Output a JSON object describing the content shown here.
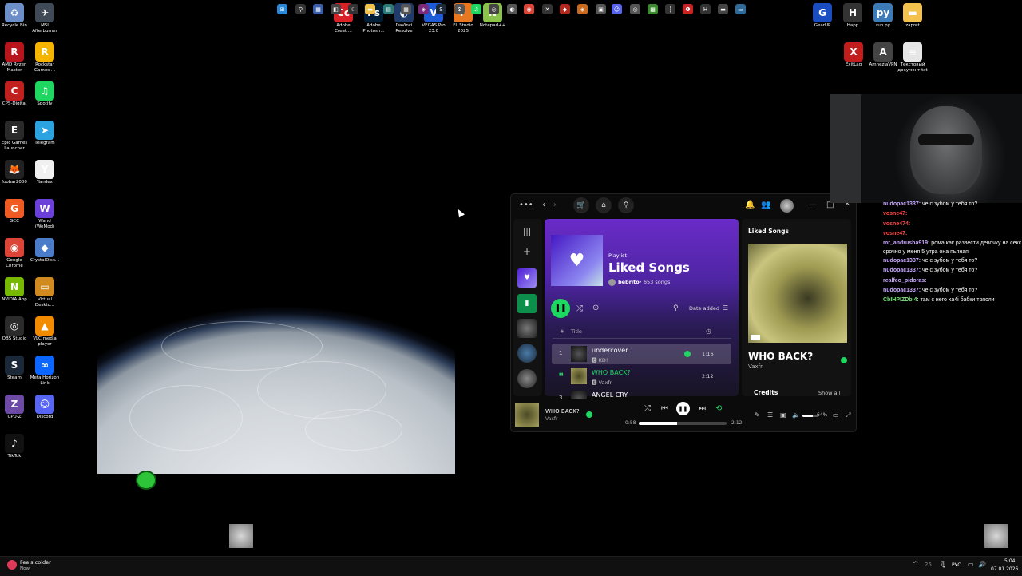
{
  "desktop": {
    "icons_left": [
      {
        "label": "Recycle Bin",
        "icon": "recycle-bin-icon",
        "color": "#6c8ec9",
        "glyph": "♻"
      },
      {
        "label": "MSI Afterburner",
        "icon": "msi-afterburner-icon",
        "color": "#3f4a56",
        "glyph": "✈"
      },
      {
        "label": "AMD Ryzen Master",
        "icon": "amd-ryzen-icon",
        "color": "#b8141b",
        "glyph": "R"
      },
      {
        "label": "Rockstar Games ...",
        "icon": "rockstar-icon",
        "color": "#f5b400",
        "glyph": "R"
      },
      {
        "label": "CPS-Digital",
        "icon": "cps-digital-icon",
        "color": "#c2201f",
        "glyph": "C"
      },
      {
        "label": "Spotify",
        "icon": "spotify-icon",
        "color": "#1ed760",
        "glyph": "♫"
      },
      {
        "label": "Epic Games Launcher",
        "icon": "epic-games-icon",
        "color": "#2a2a2a",
        "glyph": "E"
      },
      {
        "label": "Telegram",
        "icon": "telegram-icon",
        "color": "#2aa3e0",
        "glyph": "➤"
      },
      {
        "label": "foobar2000",
        "icon": "foobar-icon",
        "color": "#222",
        "glyph": "🦊"
      },
      {
        "label": "Yandex",
        "icon": "yandex-icon",
        "color": "#f0f0f0",
        "glyph": "Y"
      },
      {
        "label": "GCC",
        "icon": "gcc-icon",
        "color": "#f05a23",
        "glyph": "G"
      },
      {
        "label": "Wand (WeMod)",
        "icon": "wand-icon",
        "color": "#6b3fd9",
        "glyph": "W"
      },
      {
        "label": "Google Chrome",
        "icon": "chrome-icon",
        "color": "#db4437",
        "glyph": "◉"
      },
      {
        "label": "CrystalDisk...",
        "icon": "crystaldisk-icon",
        "color": "#4b7cc9",
        "glyph": "◆"
      },
      {
        "label": "NVIDIA App",
        "icon": "nvidia-icon",
        "color": "#76b900",
        "glyph": "N"
      },
      {
        "label": "Virtual Deskto...",
        "icon": "virtual-desktop-icon",
        "color": "#d08a1e",
        "glyph": "▭"
      },
      {
        "label": "OBS Studio",
        "icon": "obs-icon",
        "color": "#2b2b2b",
        "glyph": "◎"
      },
      {
        "label": "VLC media player",
        "icon": "vlc-icon",
        "color": "#f28b00",
        "glyph": "▲"
      },
      {
        "label": "Steam",
        "icon": "steam-icon",
        "color": "#1b2838",
        "glyph": "S"
      },
      {
        "label": "Meta Horizon Link",
        "icon": "meta-icon",
        "color": "#0a66ff",
        "glyph": "∞"
      },
      {
        "label": "CPU-Z",
        "icon": "cpuz-icon",
        "color": "#6c4aa6",
        "glyph": "Z"
      },
      {
        "label": "Discord",
        "icon": "discord-icon",
        "color": "#5865f2",
        "glyph": "☺"
      },
      {
        "label": "TikTok",
        "icon": "tiktok-icon",
        "color": "#111",
        "glyph": "♪"
      }
    ],
    "icons_top": [
      {
        "label": "Adobe Creati...",
        "icon": "adobe-cc-icon",
        "color": "#da1f26",
        "glyph": "Cc"
      },
      {
        "label": "Adobe Photosh...",
        "icon": "photoshop-icon",
        "color": "#001e36",
        "glyph": "Ps"
      },
      {
        "label": "DaVinci Resolve",
        "icon": "davinci-icon",
        "color": "#1f3b6b",
        "glyph": "◐"
      },
      {
        "label": "VEGAS Pro 23.0",
        "icon": "vegas-icon",
        "color": "#1e5bd6",
        "glyph": "V"
      },
      {
        "label": "FL Studio 2025",
        "icon": "fl-studio-icon",
        "color": "#e87722",
        "glyph": "F"
      },
      {
        "label": "Notepad++",
        "icon": "notepadpp-icon",
        "color": "#8bc34a",
        "glyph": "N"
      }
    ],
    "icons_right": [
      {
        "label": "GearUP",
        "icon": "gearup-icon",
        "color": "#1a4dbf",
        "glyph": "G"
      },
      {
        "label": "Happ",
        "icon": "happ-icon",
        "color": "#333",
        "glyph": "H"
      },
      {
        "label": "run.py",
        "icon": "python-file-icon",
        "color": "#3d7ab8",
        "glyph": "py"
      },
      {
        "label": "zapret",
        "icon": "folder-icon",
        "color": "#f2c14e",
        "glyph": "▬"
      },
      {
        "label": "ExitLag",
        "icon": "exitlag-icon",
        "color": "#c21d1d",
        "glyph": "X"
      },
      {
        "label": "AmneziaVPN",
        "icon": "amnezia-icon",
        "color": "#444",
        "glyph": "A"
      },
      {
        "label": "Текстовый документ.txt",
        "icon": "text-file-icon",
        "color": "#e6e6e6",
        "glyph": "≡"
      }
    ]
  },
  "spotify": {
    "playlist_kind": "Playlist",
    "playlist_title": "Liked Songs",
    "owner": "bebrito",
    "song_count": "• 653 songs",
    "sort_label": "Date added",
    "col_hash": "#",
    "col_title": "Title",
    "tracks": [
      {
        "num": "1",
        "title": "undercover",
        "artist": "KD!",
        "duration": "1:16",
        "active": false,
        "liked": true
      },
      {
        "num": "",
        "title": "WHO BACK?",
        "artist": "Vaxfr",
        "duration": "2:12",
        "active": true,
        "liked": false
      },
      {
        "num": "3",
        "title": "ANGEL CRY",
        "artist": "",
        "duration": "",
        "active": false,
        "liked": false
      }
    ],
    "right_panel": {
      "header": "Liked Songs",
      "song_title": "WHO BACK?",
      "artist": "Vaxfr",
      "credits": "Credits",
      "show_all": "Show all"
    },
    "now_playing": {
      "title": "WHO BACK?",
      "artist": "Vaxfr",
      "elapsed": "0:58",
      "total": "2:12",
      "progress": 0.44,
      "volume": "64%",
      "volume_level": 0.64
    }
  },
  "chat": [
    {
      "user": "nudopac1337:",
      "user_color": "#c9a8ff",
      "text": "че с зубом у тебя то?"
    },
    {
      "user": "vosne47:",
      "user_color": "#ff4b4b",
      "text": ""
    },
    {
      "user": "vosne474:",
      "user_color": "#ff4b4b",
      "text": ""
    },
    {
      "user": "vosne47:",
      "user_color": "#ff4b4b",
      "text": ""
    },
    {
      "user": "mr_andrusha919:",
      "user_color": "#c9a8ff",
      "text": "рома как развести девочку на секс срочно у меня 5 утра она пьяная"
    },
    {
      "user": "nudopac1337:",
      "user_color": "#c9a8ff",
      "text": "че с зубом у тебя то?"
    },
    {
      "user": "nudopac1337:",
      "user_color": "#c9a8ff",
      "text": "че с зубом у тебя то?"
    },
    {
      "user": "realfeo_pidoras:",
      "user_color": "#c9a8ff",
      "text": ""
    },
    {
      "user": "nudopac1337:",
      "user_color": "#c9a8ff",
      "text": "че с зубом у тебя то?"
    },
    {
      "user": "CbIHPIZDbI4:",
      "user_color": "#7be37b",
      "text": "там с него ха4i бабки трясли"
    }
  ],
  "taskbar": {
    "weather_title": "Feels colder",
    "weather_sub": "Now",
    "tray_num": "25",
    "lang": "РУС",
    "time": "5:04",
    "date": "07.01.2026"
  }
}
